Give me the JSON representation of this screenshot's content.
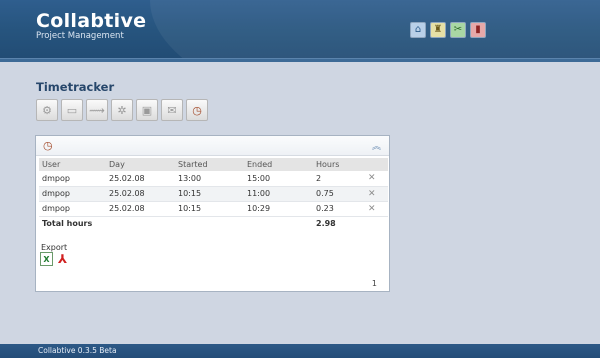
{
  "app": {
    "title": "Collabtive",
    "subtitle": "Project Management",
    "footer": "Collabtive 0.3.5 Beta"
  },
  "nav_icons": [
    "home-icon",
    "admin-icon",
    "settings-icon",
    "logout-icon"
  ],
  "page": {
    "heading": "Timetracker"
  },
  "toolbar_icons": [
    "project-icon",
    "desktop-icon",
    "milestones-icon",
    "tasks-icon",
    "files-icon",
    "messages-icon",
    "timetracker-icon"
  ],
  "timetracker": {
    "columns": {
      "user": "User",
      "day": "Day",
      "started": "Started",
      "ended": "Ended",
      "hours": "Hours"
    },
    "rows": [
      {
        "user": "dmpop",
        "day": "25.02.08",
        "started": "13:00",
        "ended": "15:00",
        "hours": "2"
      },
      {
        "user": "dmpop",
        "day": "25.02.08",
        "started": "10:15",
        "ended": "11:00",
        "hours": "0.75"
      },
      {
        "user": "dmpop",
        "day": "25.02.08",
        "started": "10:15",
        "ended": "10:29",
        "hours": "0.23"
      }
    ],
    "total_label": "Total hours",
    "total_value": "2.98",
    "export_label": "Export",
    "page_number": "1"
  },
  "colors": {
    "header": "#27557f",
    "background": "#cfd6e2",
    "heading": "#27476b"
  }
}
